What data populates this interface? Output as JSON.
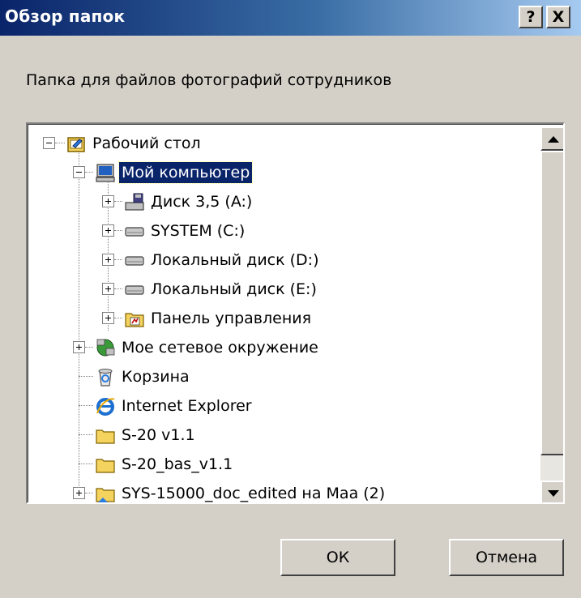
{
  "window": {
    "title": "Обзор папок",
    "help_label": "?",
    "close_label": "X"
  },
  "prompt": "Папка для файлов фотографий сотрудников",
  "tree": {
    "items": [
      {
        "label": "Рабочий стол",
        "icon": "desktop-icon",
        "expander": "minus"
      },
      {
        "label": "Мой компьютер",
        "icon": "my-computer-icon",
        "expander": "minus",
        "selected": true
      },
      {
        "label": "Диск 3,5 (A:)",
        "icon": "floppy-drive-icon",
        "expander": "plus"
      },
      {
        "label": "SYSTEM (C:)",
        "icon": "hard-drive-icon",
        "expander": "plus"
      },
      {
        "label": "Локальный диск (D:)",
        "icon": "hard-drive-icon",
        "expander": "plus"
      },
      {
        "label": "Локальный диск (E:)",
        "icon": "hard-drive-icon",
        "expander": "plus"
      },
      {
        "label": "Панель управления",
        "icon": "control-panel-icon",
        "expander": "plus"
      },
      {
        "label": "Мое сетевое окружение",
        "icon": "network-places-icon",
        "expander": "plus"
      },
      {
        "label": "Корзина",
        "icon": "recycle-bin-icon",
        "expander": "none"
      },
      {
        "label": "Internet Explorer",
        "icon": "internet-explorer-icon",
        "expander": "none"
      },
      {
        "label": "S-20 v1.1",
        "icon": "folder-icon",
        "expander": "none"
      },
      {
        "label": "S-20_bas_v1.1",
        "icon": "folder-icon",
        "expander": "none"
      },
      {
        "label": "SYS-15000_doc_edited на Маа (2)",
        "icon": "shared-folder-icon",
        "expander": "plus"
      }
    ]
  },
  "buttons": {
    "ok": "ОК",
    "cancel": "Отмена"
  },
  "colors": {
    "title_bar_start": "#0a246a",
    "title_bar_end": "#a6caf0",
    "dialog_background": "#d4d0c8",
    "selection": "#0a246a"
  }
}
